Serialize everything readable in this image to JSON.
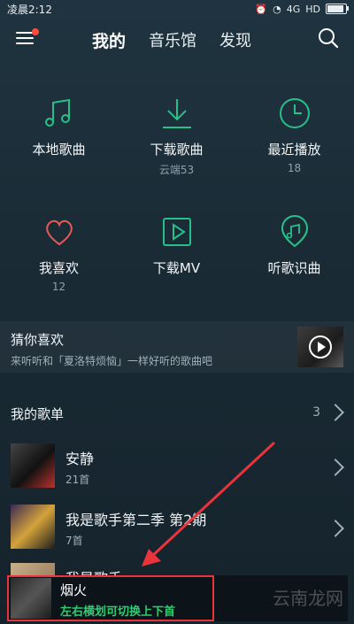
{
  "status_bar": {
    "time": "凌晨2:12",
    "signal": "4G",
    "net": "HD"
  },
  "tabs": [
    {
      "label": "我的"
    },
    {
      "label": "音乐馆"
    },
    {
      "label": "发现"
    }
  ],
  "grid": [
    {
      "label": "本地歌曲",
      "sub": "",
      "icon": "music-note-icon"
    },
    {
      "label": "下载歌曲",
      "sub": "云端53",
      "icon": "download-icon"
    },
    {
      "label": "最近播放",
      "sub": "18",
      "icon": "clock-icon"
    },
    {
      "label": "我喜欢",
      "sub": "12",
      "icon": "heart-icon"
    },
    {
      "label": "下载MV",
      "sub": "",
      "icon": "mv-play-icon"
    },
    {
      "label": "听歌识曲",
      "sub": "",
      "icon": "recognize-icon"
    }
  ],
  "recommend": {
    "title": "猜你喜欢",
    "desc": "来听听和「夏洛特烦恼」一样好听的歌曲吧"
  },
  "my_playlists": {
    "title": "我的歌单",
    "count": "3",
    "items": [
      {
        "name": "安静",
        "count": "21首"
      },
      {
        "name": "我是歌手第二季 第2期",
        "count": "7首"
      },
      {
        "name": "我是歌手",
        "count": ""
      }
    ]
  },
  "mini_player": {
    "title": "烟火",
    "hint": "左右横划可切换上下首"
  },
  "watermark": "云南龙网",
  "colors": {
    "accent_green": "#2ecc71",
    "highlight_red": "#e8343a",
    "icon_green": "#27c08a",
    "icon_red": "#e85a5a"
  }
}
